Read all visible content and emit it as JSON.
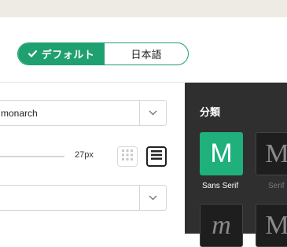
{
  "toggle": {
    "active_label": "デフォルト",
    "inactive_label": "日本語"
  },
  "font_select": {
    "value": "monarch"
  },
  "size": {
    "label": "27px"
  },
  "categories": {
    "title": "分類",
    "tiles": [
      {
        "glyph": "M",
        "label": "Sans Serif",
        "active": true
      },
      {
        "glyph": "M",
        "label": "Serif",
        "active": false
      },
      {
        "glyph": "m",
        "label": "",
        "active": false
      },
      {
        "glyph": "M",
        "label": "",
        "active": false
      }
    ]
  },
  "colors": {
    "accent": "#1fa070",
    "dark_panel": "#2f2f2f",
    "topbar": "#eeebe4"
  },
  "icons": [
    "check-icon",
    "chevron-down-icon",
    "grid-view-icon",
    "list-view-icon"
  ]
}
